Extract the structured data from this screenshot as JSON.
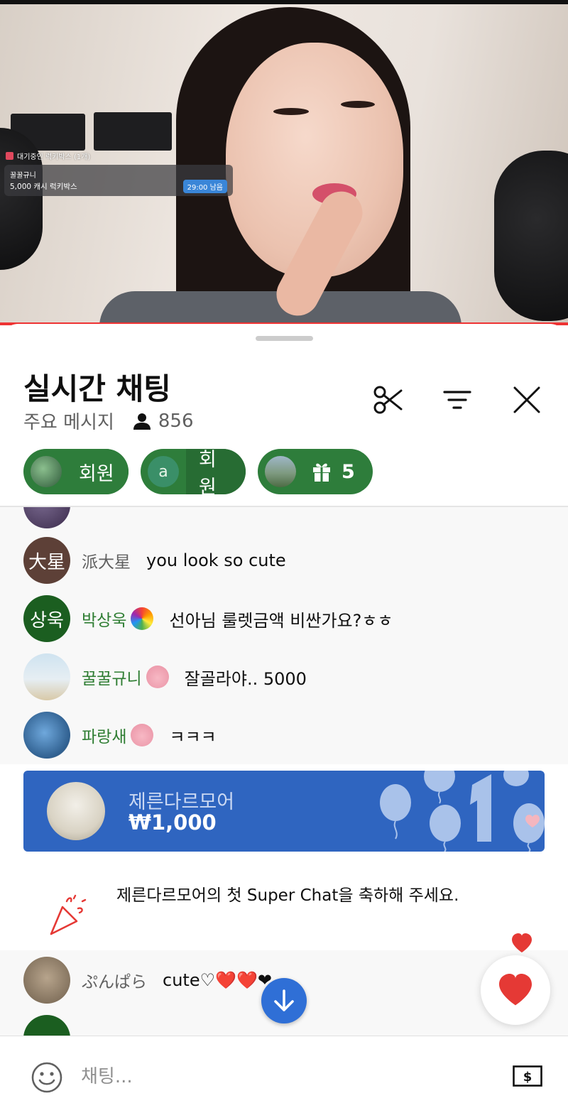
{
  "video": {
    "lucky_box_label": "대기중인 럭키박스 (1개)",
    "lucky_box_user": "꿀꿀규니",
    "lucky_box_amount": "5,000 캐시 럭키박스",
    "lucky_box_timer": "29:00 남음"
  },
  "header": {
    "title": "실시간 채팅",
    "mode": "주요 메시지",
    "viewer_count": "856"
  },
  "chips": [
    {
      "label": "회원",
      "avatar_letter": ""
    },
    {
      "label": "회원",
      "avatar_letter": "a"
    },
    {
      "label": "5",
      "icon": "gift-icon"
    }
  ],
  "messages": [
    {
      "author": "派大星",
      "avatar_text": "大星",
      "text": "you look so cute",
      "member": false
    },
    {
      "author": "박상욱",
      "avatar_text": "상욱",
      "text": "선아님 룰렛금액 비싼가요?ㅎㅎ",
      "member": true
    },
    {
      "author": "꿀꿀규니",
      "avatar_text": "",
      "text": "잘골라야.. 5000",
      "member": true
    },
    {
      "author": "파랑새",
      "avatar_text": "",
      "text": "ㅋㅋㅋ",
      "member": true
    }
  ],
  "superchat": {
    "name": "제른다르모어",
    "amount": "₩1,000"
  },
  "congrats": {
    "text": "제른다르모어의 첫 Super Chat을 축하해 주세요."
  },
  "messages2": [
    {
      "author": "ぷんぱら",
      "text": "cute♡❤️❤️❤"
    }
  ],
  "input": {
    "placeholder": "채팅..."
  },
  "colors": {
    "member_green": "#2e7d32",
    "chip_green": "#2e7d3b",
    "superchat_blue": "#2f65c0",
    "scroll_button_blue": "#2f6fd6"
  }
}
